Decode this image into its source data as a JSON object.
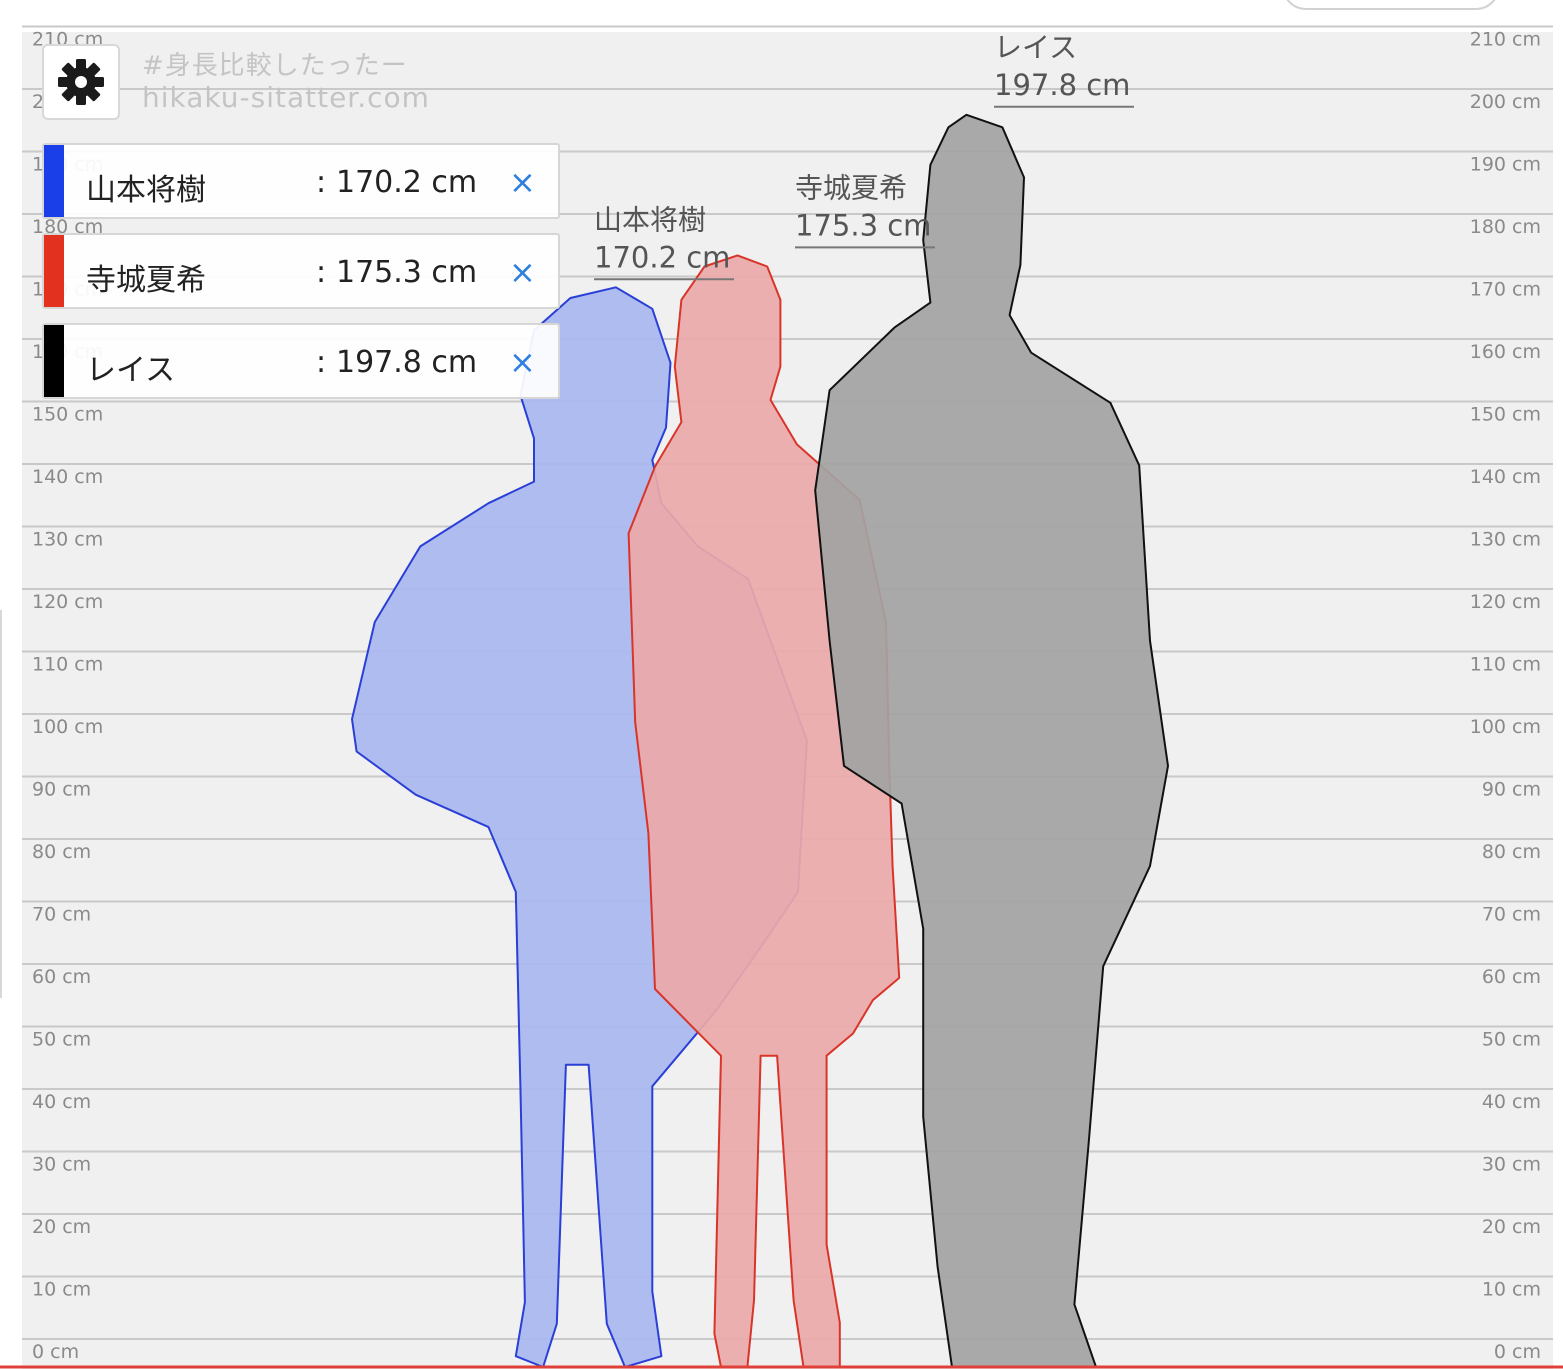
{
  "chart_data": {
    "type": "bar",
    "title": "",
    "xlabel": "",
    "ylabel": "",
    "ylim": [
      0,
      210
    ],
    "y_tick_step": 10,
    "y_unit": "cm",
    "grid": true,
    "y_tick_labels": [
      "0 cm",
      "10 cm",
      "20 cm",
      "30 cm",
      "40 cm",
      "50 cm",
      "60 cm",
      "70 cm",
      "80 cm",
      "90 cm",
      "100 cm",
      "110 cm",
      "120 cm",
      "130 cm",
      "140 cm",
      "150 cm",
      "160 cm",
      "170 cm",
      "180 cm",
      "190 cm",
      "200 cm",
      "210 cm"
    ],
    "categories": [
      "山本将樹",
      "寺城夏希",
      "レイス"
    ],
    "values": [
      170.2,
      175.3,
      197.8
    ],
    "series": [
      {
        "name": "山本将樹",
        "value": 170.2,
        "label": "170.2 cm",
        "color": "#1a3ee8",
        "fill": "#a9b7f0",
        "stroke": "#2a3fd6"
      },
      {
        "name": "寺城夏希",
        "value": 175.3,
        "label": "175.3 cm",
        "color": "#e2311f",
        "fill": "#eca9a9",
        "stroke": "#d8352a"
      },
      {
        "name": "レイス",
        "value": 197.8,
        "label": "197.8 cm",
        "color": "#000000",
        "fill": "#a3a3a3",
        "stroke": "#111111"
      }
    ],
    "legend_position": "top-left"
  },
  "watermark": {
    "tag": "#身長比較したったー",
    "url": "hikaku-sitatter.com"
  },
  "legend_separator": ":",
  "icons": {
    "settings": "gear-icon",
    "remove": "close-icon",
    "remove_glyph": "×"
  },
  "colors": {
    "background": "#f0f0f0",
    "gridline": "#c9c9c9",
    "tick_text": "#8a8a8a",
    "baseline": "#e0403a",
    "remove_icon": "#2f7fe0"
  }
}
